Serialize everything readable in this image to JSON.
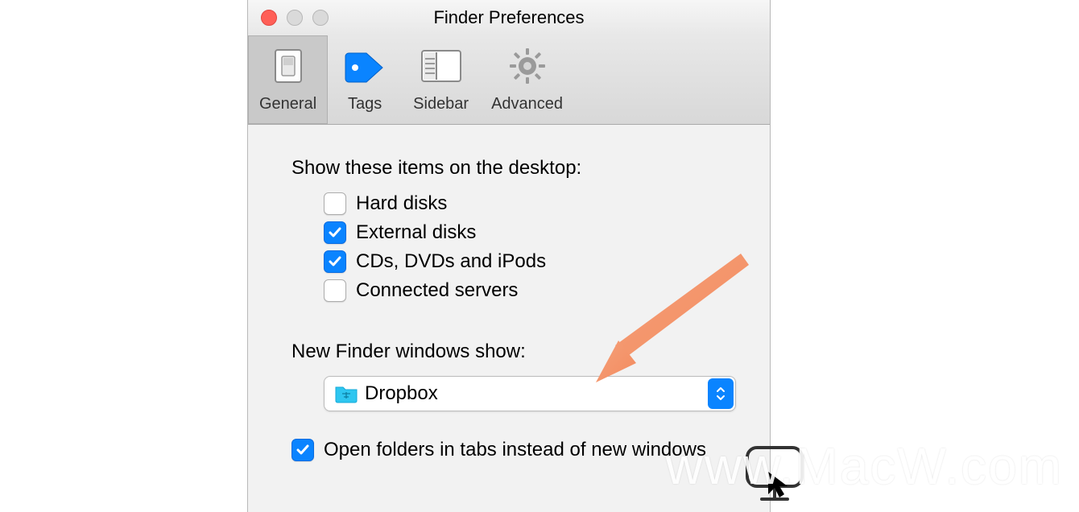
{
  "window_title": "Finder Preferences",
  "tabs": [
    {
      "label": "General"
    },
    {
      "label": "Tags"
    },
    {
      "label": "Sidebar"
    },
    {
      "label": "Advanced"
    }
  ],
  "sections": {
    "desktop_label": "Show these items on the desktop:",
    "items": [
      {
        "label": "Hard disks",
        "checked": false
      },
      {
        "label": "External disks",
        "checked": true
      },
      {
        "label": "CDs, DVDs and iPods",
        "checked": true
      },
      {
        "label": "Connected servers",
        "checked": false
      }
    ],
    "new_windows_label": "New Finder windows show:",
    "new_windows_value": "Dropbox",
    "open_in_tabs_label": "Open folders in tabs instead of new windows",
    "open_in_tabs_checked": true
  },
  "watermark": "www.MacW.com",
  "colors": {
    "accent": "#0a84ff",
    "arrow": "#f5a07a"
  }
}
